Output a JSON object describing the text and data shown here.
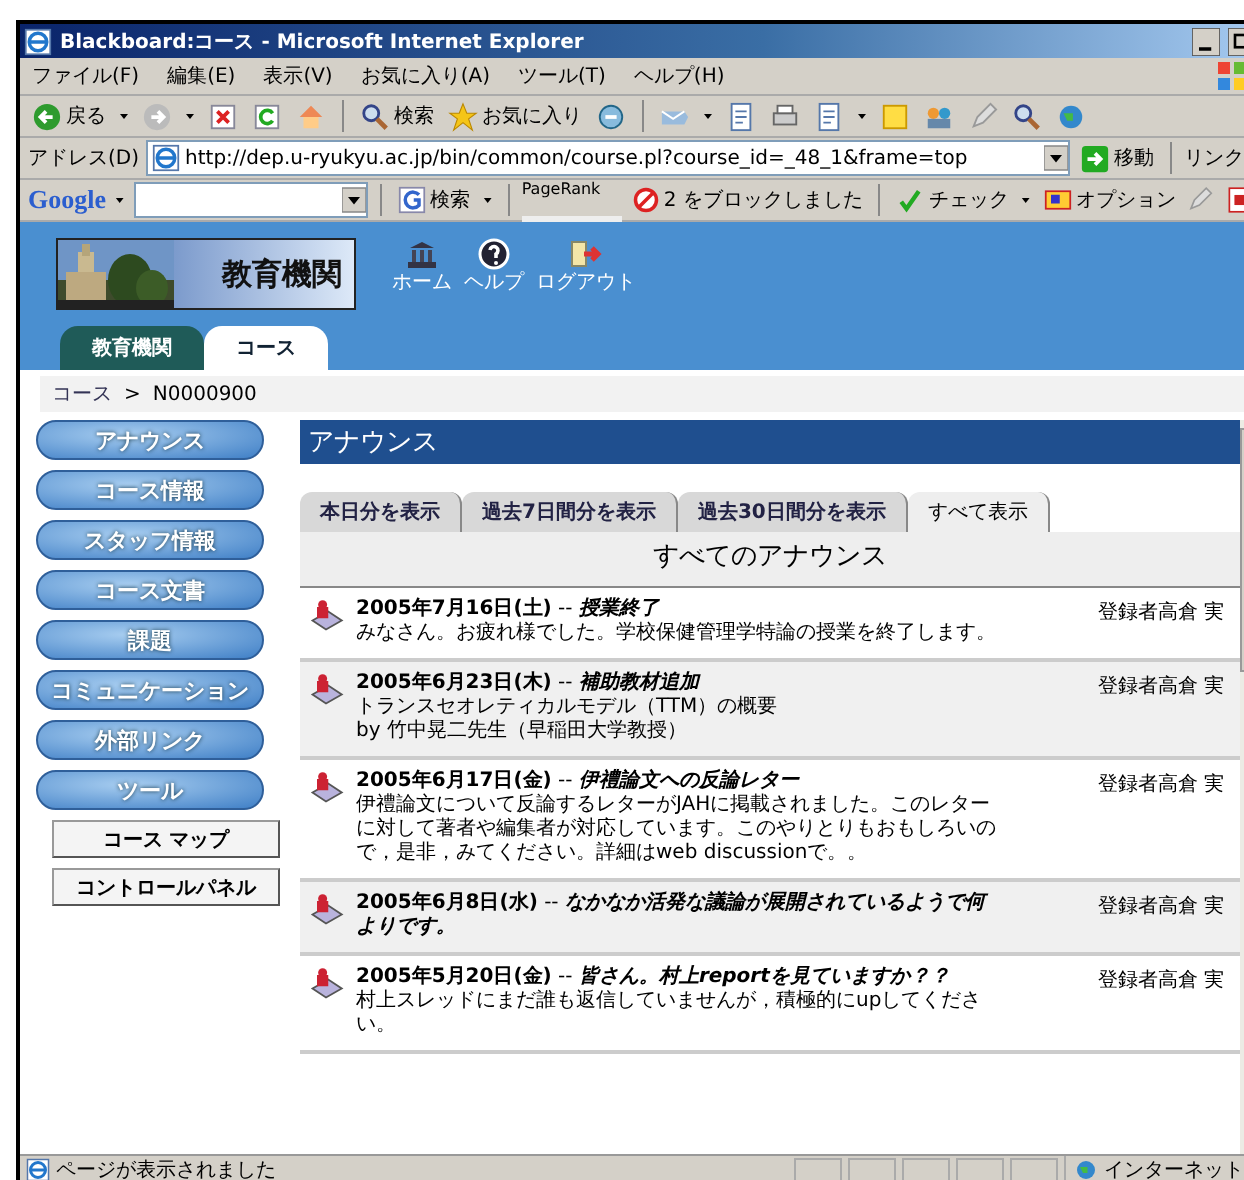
{
  "window": {
    "title": "Blackboard:コース - Microsoft Internet Explorer"
  },
  "menu": [
    "ファイル(F)",
    "編集(E)",
    "表示(V)",
    "お気に入り(A)",
    "ツール(T)",
    "ヘルプ(H)"
  ],
  "toolbar": {
    "back": "戻る",
    "search": "検索",
    "favorites": "お気に入り"
  },
  "address_bar": {
    "label": "アドレス(D)",
    "value": "http://dep.u-ryukyu.ac.jp/bin/common/course.pl?course_id=_48_1&frame=top",
    "go": "移動",
    "links": "リンク"
  },
  "google_bar": {
    "logo": "Google",
    "search": "検索",
    "pagerank": "PageRank",
    "blocked": "2 をブロックしました",
    "check": "チェック",
    "options": "オプション"
  },
  "header": {
    "institution": "教育機関",
    "icons": [
      {
        "kind": "home",
        "label": "ホーム"
      },
      {
        "kind": "help",
        "label": "ヘルプ"
      },
      {
        "kind": "logout",
        "label": "ログアウト"
      }
    ]
  },
  "main_tabs": [
    {
      "label": "教育機関",
      "selected": false
    },
    {
      "label": "コース",
      "selected": true
    }
  ],
  "breadcrumb": {
    "link": "コース",
    "separator": ">",
    "current": "N0000900"
  },
  "sidebar": {
    "items": [
      "アナウンス",
      "コース情報",
      "スタッフ情報",
      "コース文書",
      "課題",
      "コミュニケーション",
      "外部リンク",
      "ツール"
    ],
    "tools": [
      "コース マップ",
      "コントロールパネル"
    ]
  },
  "content": {
    "title": "アナウンス",
    "filters": [
      {
        "label": "本日分を表示",
        "selected": false
      },
      {
        "label": "過去7日間分を表示",
        "selected": false
      },
      {
        "label": "過去30日間分を表示",
        "selected": false
      },
      {
        "label": "すべて表示",
        "selected": true
      }
    ],
    "heading": "すべてのアナウンス",
    "announcements": [
      {
        "headline": "**2005年7月16日(土)** -- *授業終了*",
        "body": "みなさん。お疲れ様でした。学校保健管理学特論の授業を終了します。",
        "author": "登録者高倉 実"
      },
      {
        "headline": "**2005年6月23日(木)** -- *補助教材追加*",
        "body": "トランスセオレティカルモデル（TTM）の概要\nby 竹中晃二先生（早稲田大学教授）",
        "author": "登録者高倉 実"
      },
      {
        "headline": "**2005年6月17日(金)** -- *伊禮論文への反論レター*",
        "body": "伊禮論文について反論するレターがJAHに掲載されました。このレターに対して著者や編集者が対応しています。このやりとりもおもしろいので，是非，みてください。詳細はweb discussionで。。",
        "author": "登録者高倉 実"
      },
      {
        "headline": "**2005年6月8日(水)** -- *なかなか活発な議論が展開されているようで何よりです。*",
        "author": "登録者高倉 実"
      },
      {
        "headline": "**2005年5月20日(金)** -- *皆さん。村上reportを見ていますか？？*",
        "body": "村上スレッドにまだ誰も返信していませんが，積極的にupしてください。",
        "author": "登録者高倉 実"
      }
    ]
  },
  "status_bar": {
    "message": "ページが表示されました",
    "zone": "インターネット"
  }
}
